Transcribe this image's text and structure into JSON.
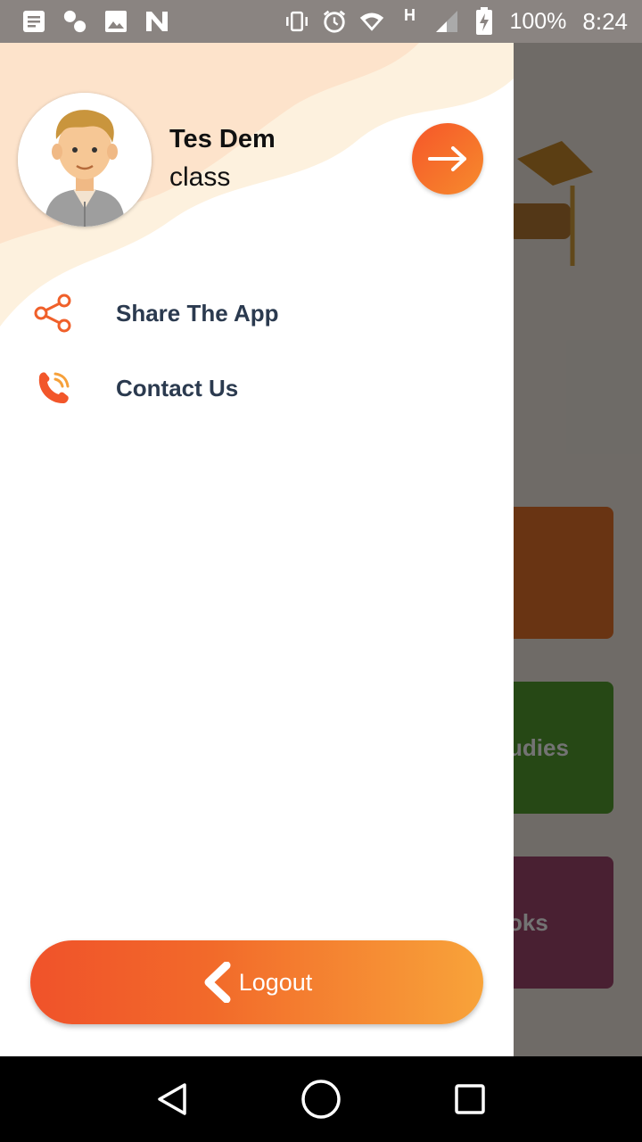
{
  "status_bar": {
    "left_icons": [
      "notification-icon",
      "percent-icon",
      "image-icon",
      "n-icon"
    ],
    "right_icons": [
      "vibrate-icon",
      "alarm-icon",
      "wifi-icon",
      "network-h-icon",
      "signal-icon",
      "battery-charging-icon"
    ],
    "network_type": "H",
    "battery": "100%",
    "time": "8:24"
  },
  "background_app": {
    "card_2_partial_label": "udies",
    "card_3_partial_label": "oks",
    "colors": {
      "card_1": "#e8732c",
      "card_2": "#55a12f",
      "card_3": "#a3476f"
    }
  },
  "drawer": {
    "user": {
      "name": "Tes Dem",
      "class_label": "class"
    },
    "go_icon": "arrow-right-icon",
    "menu": [
      {
        "label": "Share The App",
        "icon": "share-icon"
      },
      {
        "label": "Contact Us",
        "icon": "phone-icon"
      }
    ],
    "logout": {
      "label": "Logout",
      "icon": "chevron-left-icon"
    },
    "colors": {
      "accent_start": "#f0522a",
      "accent_end": "#f8a33a",
      "menu_text": "#2b3a4f"
    }
  },
  "nav_bar": {
    "buttons": [
      "back-icon",
      "home-icon",
      "recents-icon"
    ]
  }
}
